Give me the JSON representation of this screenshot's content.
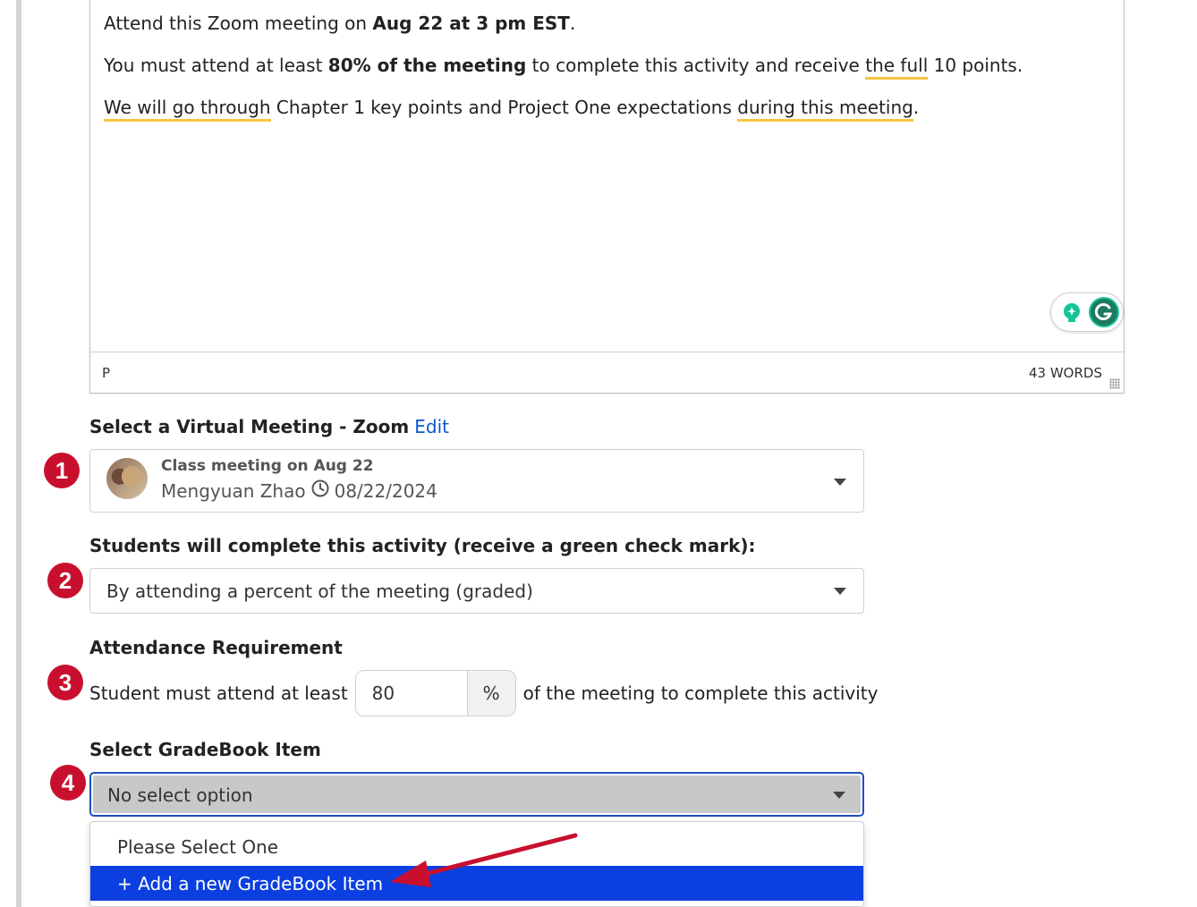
{
  "editor": {
    "line1": {
      "pre": "Attend this Zoom meeting on ",
      "bold": "Aug 22 at 3 pm EST",
      "post": "."
    },
    "line2": {
      "pre": "You must attend at least ",
      "bold": "80% of the meeting",
      "mid": " to complete this activity and receive ",
      "under": "the full",
      "post": " 10 points."
    },
    "line3": {
      "under1": "We will go through",
      "mid": " Chapter 1 key points and Project One expectations ",
      "under2": "during this meeting",
      "post": "."
    },
    "path": "P",
    "word_count": "43 WORDS"
  },
  "virtual_meeting": {
    "label": "Select a Virtual Meeting - Zoom",
    "edit_link": "Edit",
    "step": "1",
    "meeting_title": "Class meeting on Aug 22",
    "host": "Mengyuan Zhao",
    "date": "08/22/2024"
  },
  "completion": {
    "label": "Students will complete this activity (receive a green check mark):",
    "step": "2",
    "value": "By attending a percent of the meeting (graded)"
  },
  "attendance": {
    "label": "Attendance Requirement",
    "step": "3",
    "prefix": "Student must attend at least",
    "value": "80",
    "unit": "%",
    "suffix": "of the meeting to complete this activity"
  },
  "gradebook": {
    "label": "Select GradeBook Item",
    "step": "4",
    "value": "No select option",
    "options": [
      "Please Select One",
      "+ Add a new GradeBook Item"
    ],
    "highlighted_option": "+ Add a new GradeBook Item"
  },
  "colors": {
    "step_badge": "#c8102e",
    "link": "#0a58ca",
    "highlight": "#0b3fe0",
    "annotation_arrow": "#c8102e",
    "grammar_underline": "#f5c542"
  }
}
